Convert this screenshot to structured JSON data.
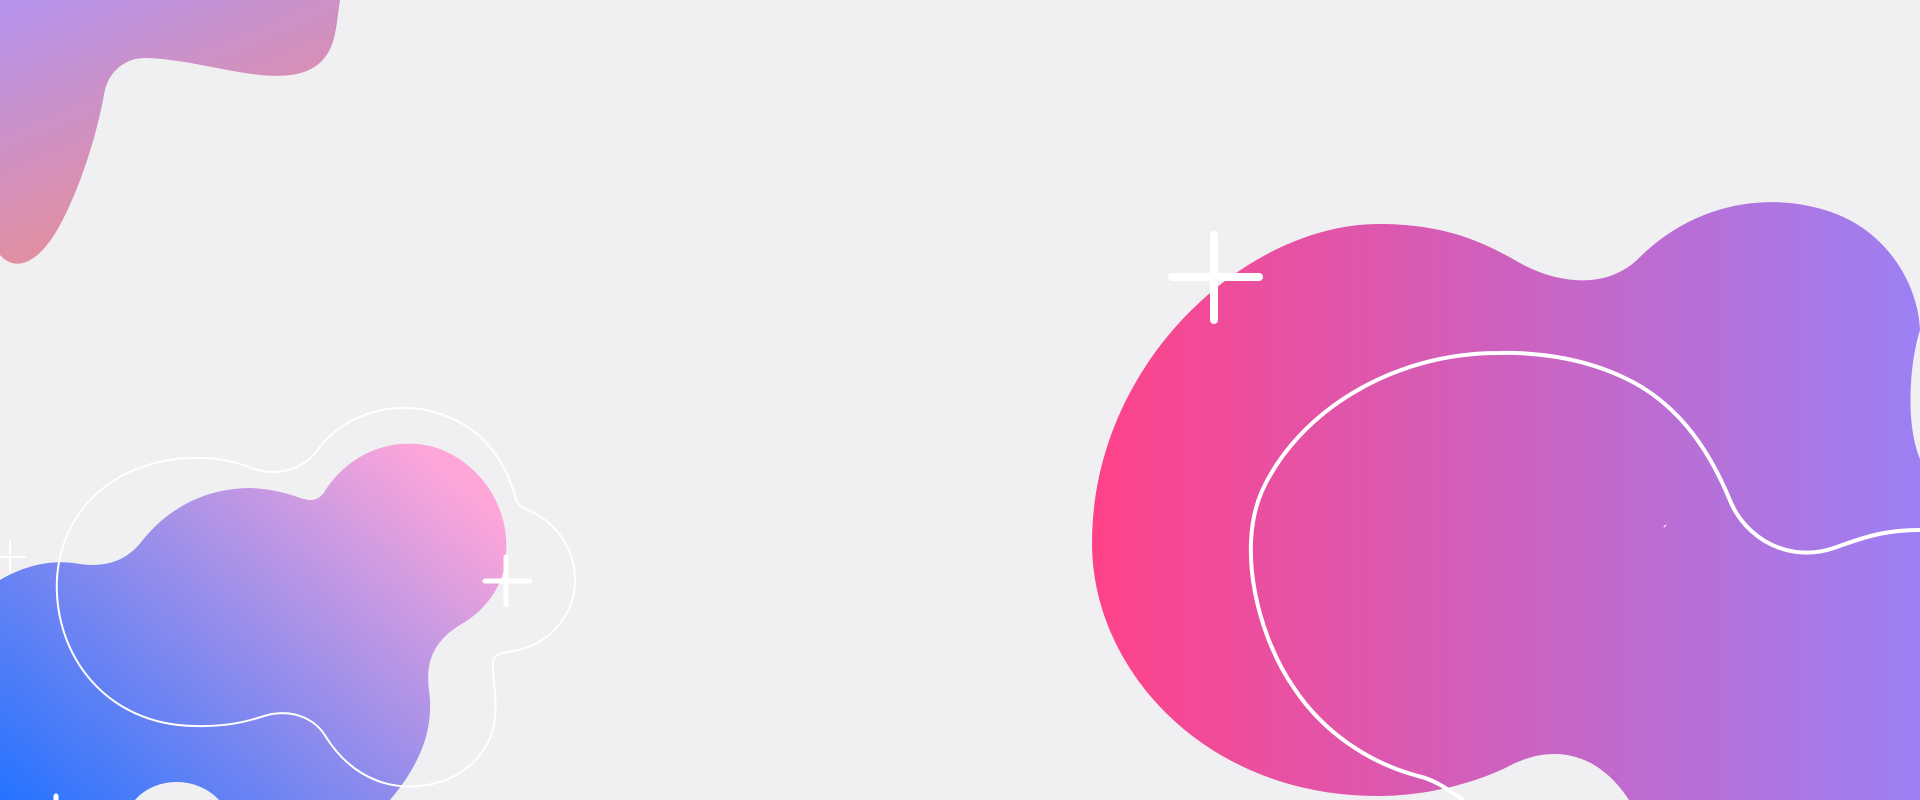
{
  "background": {
    "color": "#f0f0f2"
  },
  "colors": {
    "top_left_blob": [
      "#b493ef",
      "#ee8e8e"
    ],
    "bottom_left_blob": [
      "#2473ff",
      "#ffa6d9"
    ],
    "right_blob": [
      "#ff4289",
      "#9c80f4"
    ],
    "line": "#ffffff"
  },
  "icons": [
    "plus-icon",
    "plus-icon",
    "plus-icon"
  ]
}
